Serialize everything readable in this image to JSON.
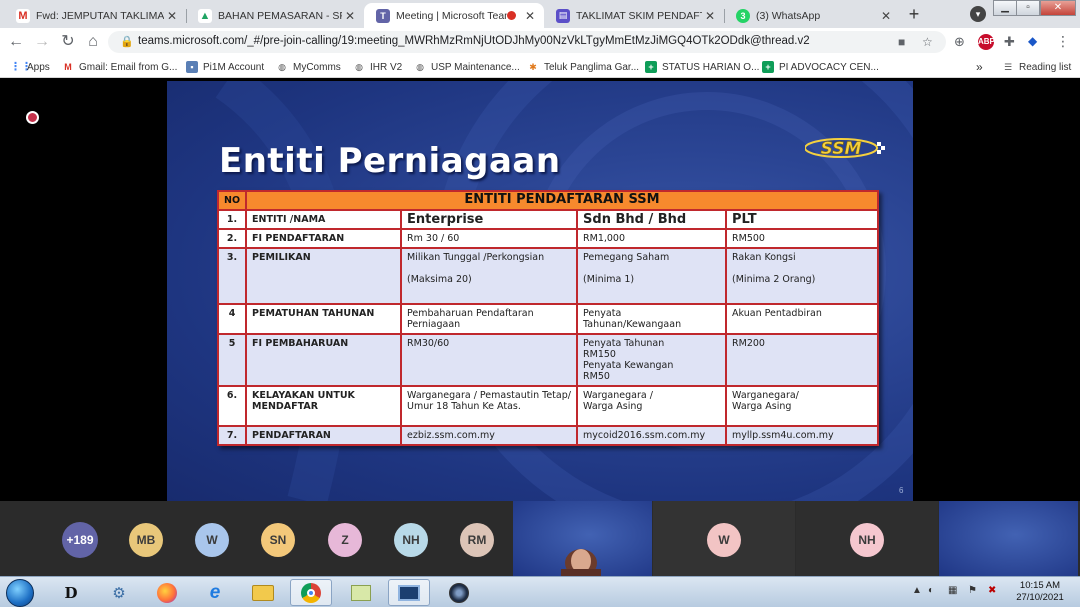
{
  "browser": {
    "tabs": [
      {
        "label": "Fwd: JEMPUTAN TAKLIMAT SKIM",
        "icon": "gmail-icon",
        "color": "#d93025",
        "letter": "M"
      },
      {
        "label": "BAHAN PEMASARAN - SPPP -",
        "icon": "google-drive-icon",
        "color": "#1fa463",
        "letter": "▲"
      },
      {
        "label": "Meeting | Microsoft Teams",
        "icon": "teams-icon",
        "color": "#6264a7",
        "letter": "T"
      },
      {
        "label": "TAKLIMAT SKIM PENDAFTARAN",
        "icon": "slides-icon",
        "color": "#5b4fc8",
        "letter": "▤"
      },
      {
        "label": "(3) WhatsApp",
        "icon": "whatsapp-icon",
        "color": "#25d366",
        "letter": "3"
      }
    ],
    "new_tab": "+",
    "url": "teams.microsoft.com/_#/pre-join-calling/19:meeting_MWRhMzRmNjUtODJhMy00NzVkLTgyMmEtMzJiMGQ4OTk2ODdk@thread.v2",
    "extensions": [
      {
        "icon": "abp-icon",
        "text": "ABP",
        "color": "#c70d2c"
      }
    ],
    "bookmarks": [
      {
        "label": "Apps",
        "icon": "apps-grid-icon",
        "color": "#4285f4"
      },
      {
        "label": "Gmail: Email from G...",
        "icon": "gmail-icon",
        "color": "#d93025"
      },
      {
        "label": "Pi1M Account",
        "icon": "pi1m-icon",
        "color": "#5a7fb5"
      },
      {
        "label": "MyComms",
        "icon": "globe-icon",
        "color": "#555555"
      },
      {
        "label": "IHR V2",
        "icon": "globe-icon",
        "color": "#555555"
      },
      {
        "label": "USP Maintenance...",
        "icon": "globe-icon",
        "color": "#555555"
      },
      {
        "label": "Teluk Panglima Gar...",
        "icon": "tpg-icon",
        "color": "#e0791b"
      },
      {
        "label": "STATUS HARIAN O...",
        "icon": "sheets-icon",
        "color": "#0f9d58"
      },
      {
        "label": "PI ADVOCACY CEN...",
        "icon": "sheets-icon",
        "color": "#0f9d58"
      }
    ],
    "bookmarks_more": "»",
    "reading_list": "Reading list"
  },
  "slide": {
    "title": "Entiti Perniagaan",
    "logo_text": "SSM",
    "page_number": "6",
    "table": {
      "no_header": "NO",
      "main_header": "ENTITI PENDAFTARAN SSM",
      "column_titles": [
        "Enterprise",
        "Sdn Bhd / Bhd",
        "PLT"
      ],
      "rows": [
        {
          "no": "1.",
          "label": "ENTITI /NAMA"
        },
        {
          "no": "2.",
          "label": "FI PENDAFTARAN",
          "c1": "Rm 30 / 60",
          "c2": "RM1,000",
          "c3": "RM500"
        },
        {
          "no": "3.",
          "label": "PEMILIKAN",
          "c1a": "Milikan Tunggal /Perkongsian",
          "c1b": "(Maksima 20)",
          "c2a": "Pemegang Saham",
          "c2b": "(Minima 1)",
          "c3a": "Rakan Kongsi",
          "c3b": "(Minima 2 Orang)"
        },
        {
          "no": "4",
          "label": "PEMATUHAN TAHUNAN",
          "c1a": "Pembaharuan Pendaftaran",
          "c1b": "Perniagaan",
          "c2a": "Penyata",
          "c2b": "Tahunan/Kewangaan",
          "c3": "Akuan Pentadbiran"
        },
        {
          "no": "5",
          "label": "FI PEMBAHARUAN",
          "c1": "RM30/60",
          "c2a": "Penyata Tahunan",
          "c2b": "RM150",
          "c2c": "Penyata Kewangan",
          "c2d": "RM50",
          "c3": "RM200"
        },
        {
          "no": "6.",
          "label_a": "KELAYAKAN UNTUK",
          "label_b": "MENDAFTAR",
          "c1a": "Warganegara / Pemastautin Tetap/",
          "c1b": "Umur 18 Tahun Ke Atas.",
          "c2a": "Warganegara /",
          "c2b": "Warga Asing",
          "c3a": "Warganegara/",
          "c3b": "Warga Asing"
        },
        {
          "no": "7.",
          "label": "PENDAFTARAN",
          "c1": "ezbiz.ssm.com.my",
          "c2": "mycoid2016.ssm.com.my",
          "c3": "myllp.ssm4u.com.my"
        }
      ]
    }
  },
  "participants": {
    "overflow": "+189",
    "avatars": [
      {
        "initials": "MB",
        "color": "#e8c77a"
      },
      {
        "initials": "W",
        "color": "#a9c6ec"
      },
      {
        "initials": "SN",
        "color": "#f3c87a"
      },
      {
        "initials": "Z",
        "color": "#e7b8d8"
      },
      {
        "initials": "NH",
        "color": "#b8d9e8"
      },
      {
        "initials": "RM",
        "color": "#dcc4b7"
      }
    ],
    "tiles": [
      {
        "initials": "W",
        "color": "#f2c4c4"
      },
      {
        "initials": "NH",
        "color": "#f5c7cf"
      }
    ]
  },
  "taskbar": {
    "apps": [
      {
        "icon": "dictionary-icon",
        "glyph": "D"
      },
      {
        "icon": "settings-icon",
        "glyph": "⚙"
      },
      {
        "icon": "firefox-icon",
        "glyph": "🦊"
      },
      {
        "icon": "internet-explorer-icon",
        "glyph": "e"
      },
      {
        "icon": "file-explorer-icon",
        "glyph": "📁"
      },
      {
        "icon": "chrome-icon",
        "glyph": "◉"
      },
      {
        "icon": "notes-icon",
        "glyph": "▤"
      },
      {
        "icon": "remote-desktop-icon",
        "glyph": "▣"
      },
      {
        "icon": "camera-icon",
        "glyph": "◎"
      }
    ],
    "time": "10:15 AM",
    "date": "27/10/2021"
  }
}
